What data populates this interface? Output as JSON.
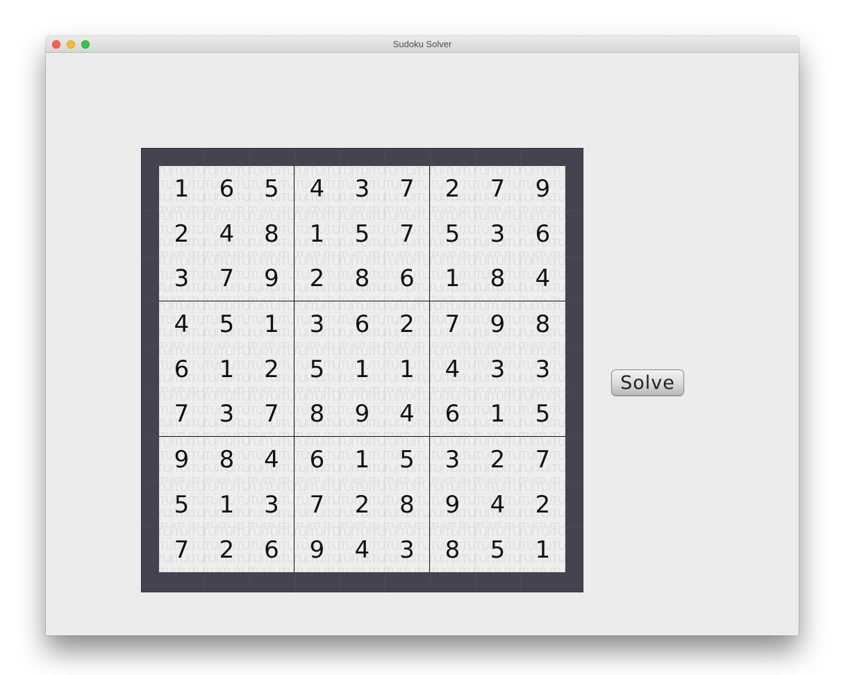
{
  "window": {
    "title": "Sudoku Solver"
  },
  "board": {
    "cell_watermark": "TUITUITU",
    "rows": [
      [
        "1",
        "6",
        "5",
        "4",
        "3",
        "7",
        "2",
        "7",
        "9"
      ],
      [
        "2",
        "4",
        "8",
        "1",
        "5",
        "7",
        "5",
        "3",
        "6"
      ],
      [
        "3",
        "7",
        "9",
        "2",
        "8",
        "6",
        "1",
        "8",
        "4"
      ],
      [
        "4",
        "5",
        "1",
        "3",
        "6",
        "2",
        "7",
        "9",
        "8"
      ],
      [
        "6",
        "1",
        "2",
        "5",
        "1",
        "1",
        "4",
        "3",
        "3"
      ],
      [
        "7",
        "3",
        "7",
        "8",
        "9",
        "4",
        "6",
        "1",
        "5"
      ],
      [
        "9",
        "8",
        "4",
        "6",
        "1",
        "5",
        "3",
        "2",
        "7"
      ],
      [
        "5",
        "1",
        "3",
        "7",
        "2",
        "8",
        "9",
        "4",
        "2"
      ],
      [
        "7",
        "2",
        "6",
        "9",
        "4",
        "3",
        "8",
        "5",
        "1"
      ]
    ]
  },
  "solve_button": {
    "label": "Solve"
  }
}
